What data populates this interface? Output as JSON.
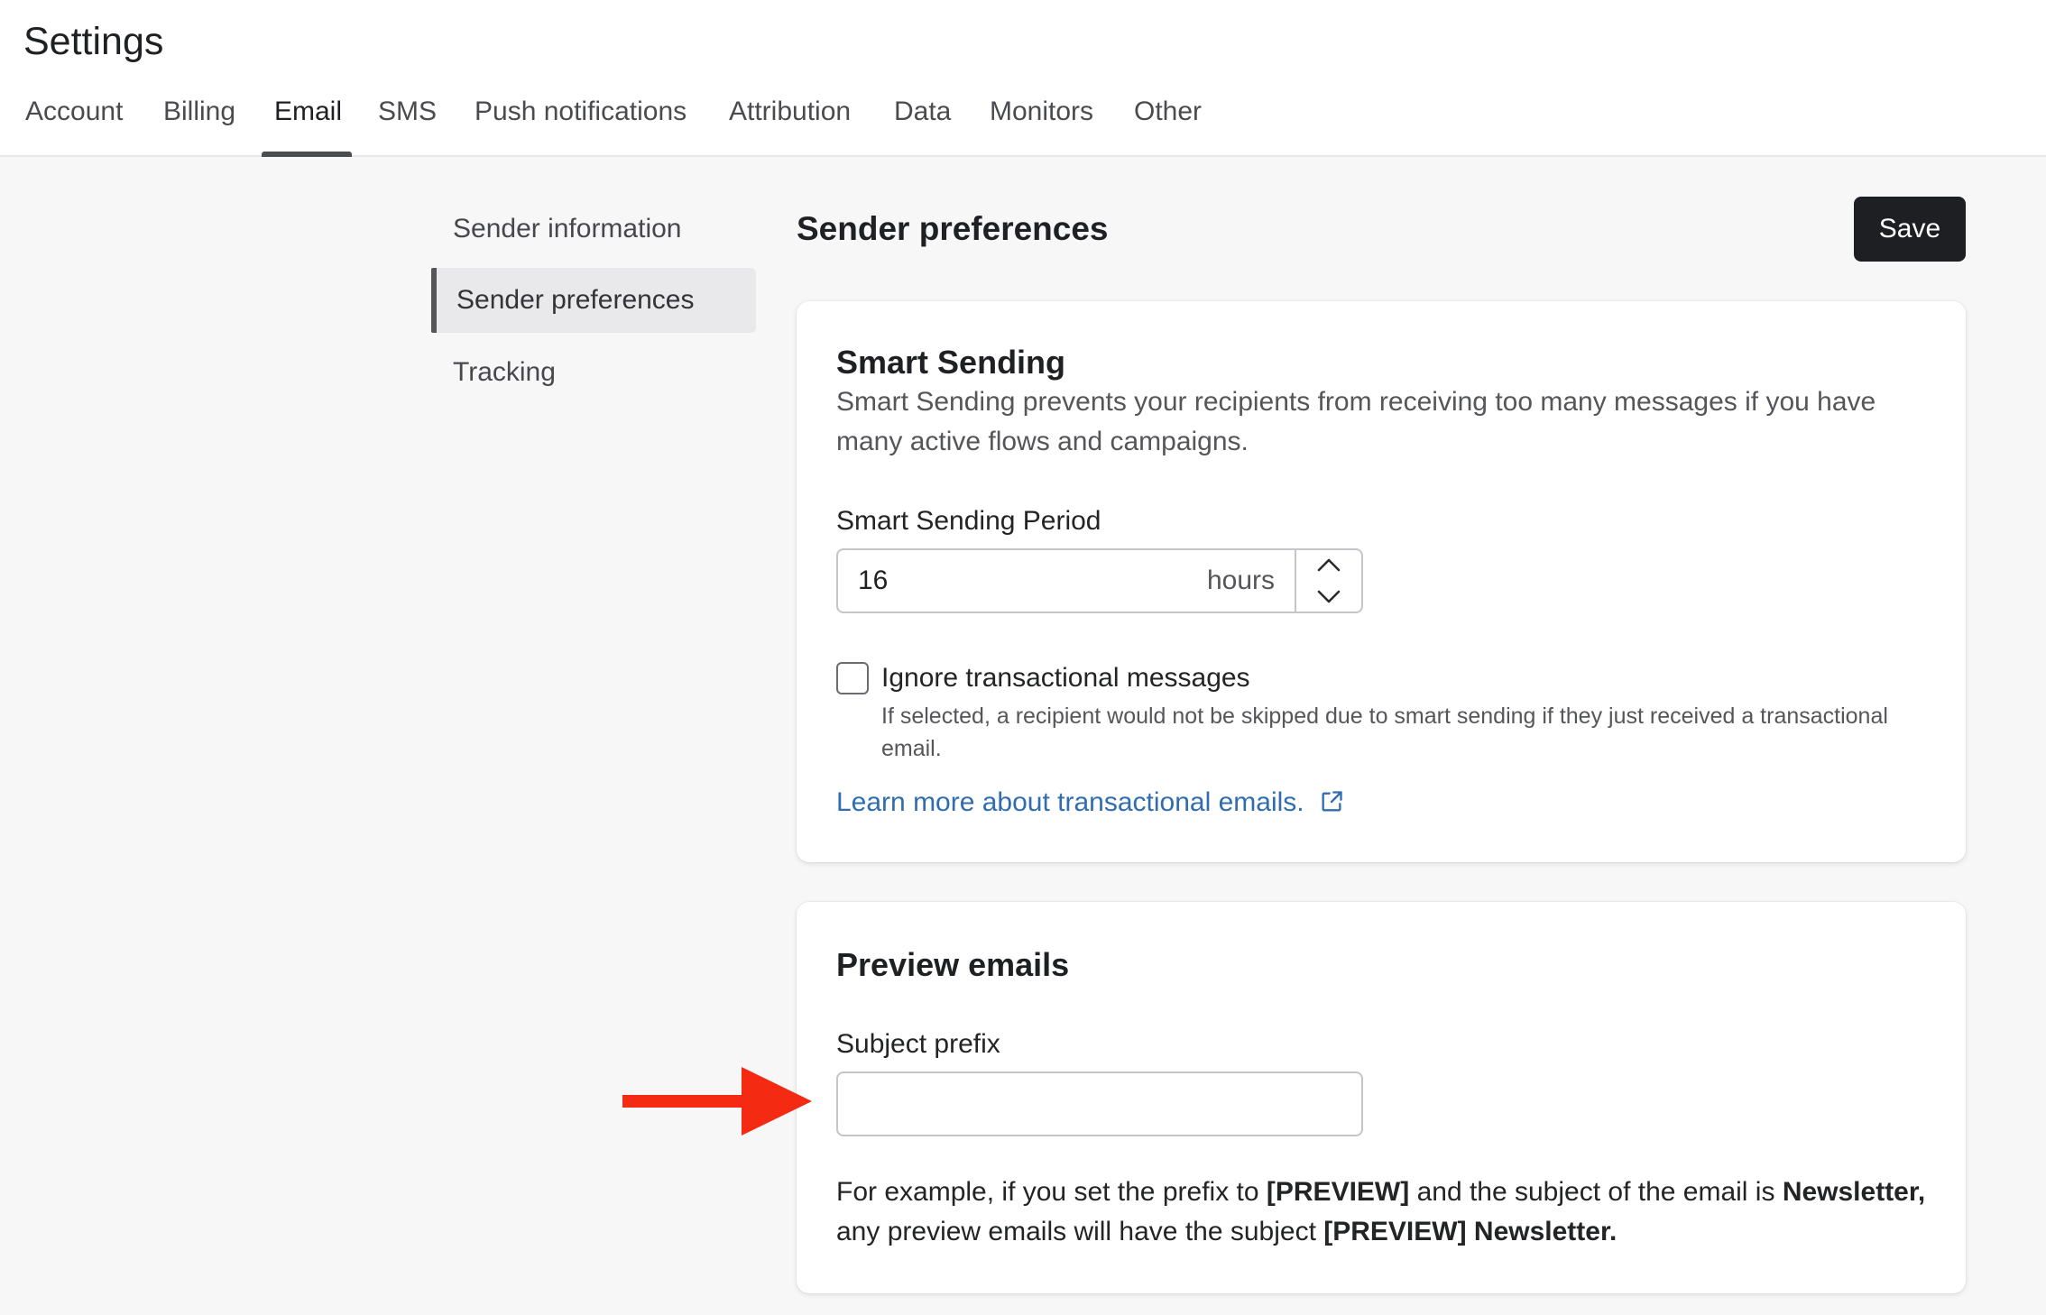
{
  "header": {
    "title": "Settings",
    "tabs": [
      {
        "label": "Account"
      },
      {
        "label": "Billing"
      },
      {
        "label": "Email",
        "active": true
      },
      {
        "label": "SMS"
      },
      {
        "label": "Push notifications"
      },
      {
        "label": "Attribution"
      },
      {
        "label": "Data"
      },
      {
        "label": "Monitors"
      },
      {
        "label": "Other"
      }
    ]
  },
  "sidenav": {
    "items": [
      {
        "label": "Sender information"
      },
      {
        "label": "Sender preferences",
        "active": true
      },
      {
        "label": "Tracking"
      }
    ]
  },
  "main": {
    "heading": "Sender preferences",
    "save_label": "Save"
  },
  "smart_sending": {
    "title": "Smart Sending",
    "description": "Smart Sending prevents your recipients from receiving too many messages if you have many active flows and campaigns.",
    "period_label": "Smart Sending Period",
    "period_value": "16",
    "period_unit": "hours",
    "checkbox_label": "Ignore transactional messages",
    "checkbox_checked": false,
    "checkbox_help": "If selected, a recipient would not be skipped due to smart sending if they just received a transactional email.",
    "link_text": "Learn more about transactional emails."
  },
  "preview_emails": {
    "title": "Preview emails",
    "prefix_label": "Subject prefix",
    "prefix_value": "",
    "example": {
      "part1": "For example, if you set the prefix to ",
      "prefix_example": "[PREVIEW]",
      "part2": " and the subject of the email is ",
      "subject_example": "Newsletter,",
      "part3": " any preview emails will have the subject ",
      "result_example": "[PREVIEW] Newsletter."
    }
  },
  "colors": {
    "accent_link": "#2f6db0",
    "save_button_bg": "#1e1f22",
    "annotation_arrow": "#f42a12"
  },
  "icons": {
    "stepper_up": "chevron-up-icon",
    "stepper_down": "chevron-down-icon",
    "external_link": "external-link-icon",
    "annotation": "red-arrow-icon"
  }
}
